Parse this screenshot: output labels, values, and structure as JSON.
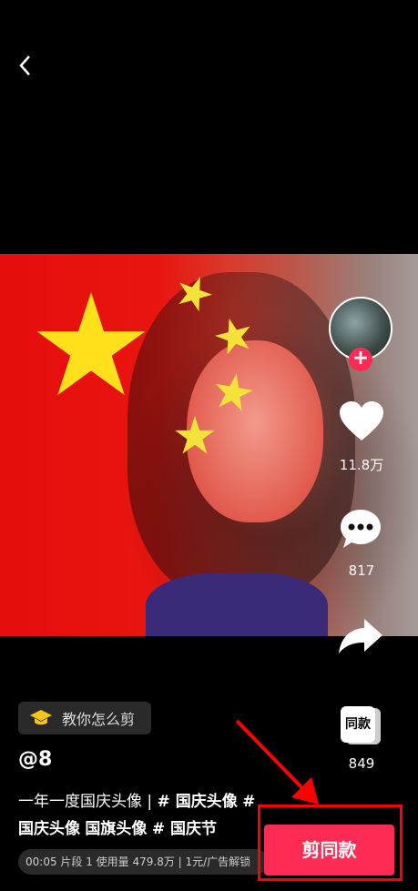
{
  "nav": {
    "back_icon": "chevron-left-icon"
  },
  "sidebar": {
    "likes": "11.8万",
    "comments": "817",
    "same_style_label": "同款",
    "same_style_count": "849"
  },
  "tutorial": {
    "label": "教你怎么剪"
  },
  "post": {
    "username": "@8",
    "desc_plain": "一年一度国庆头像 | ",
    "tags": [
      "# 国庆头像",
      "#",
      "国庆头像",
      "国旗头像",
      "# 国庆节"
    ]
  },
  "info_bar": {
    "text": "00:05 片段 1 使用量 479.8万 | 1元/广告解锁"
  },
  "cta": {
    "label": "剪同款"
  },
  "colors": {
    "accent": "#fe2c55",
    "highlight_frame": "#ff0000"
  }
}
